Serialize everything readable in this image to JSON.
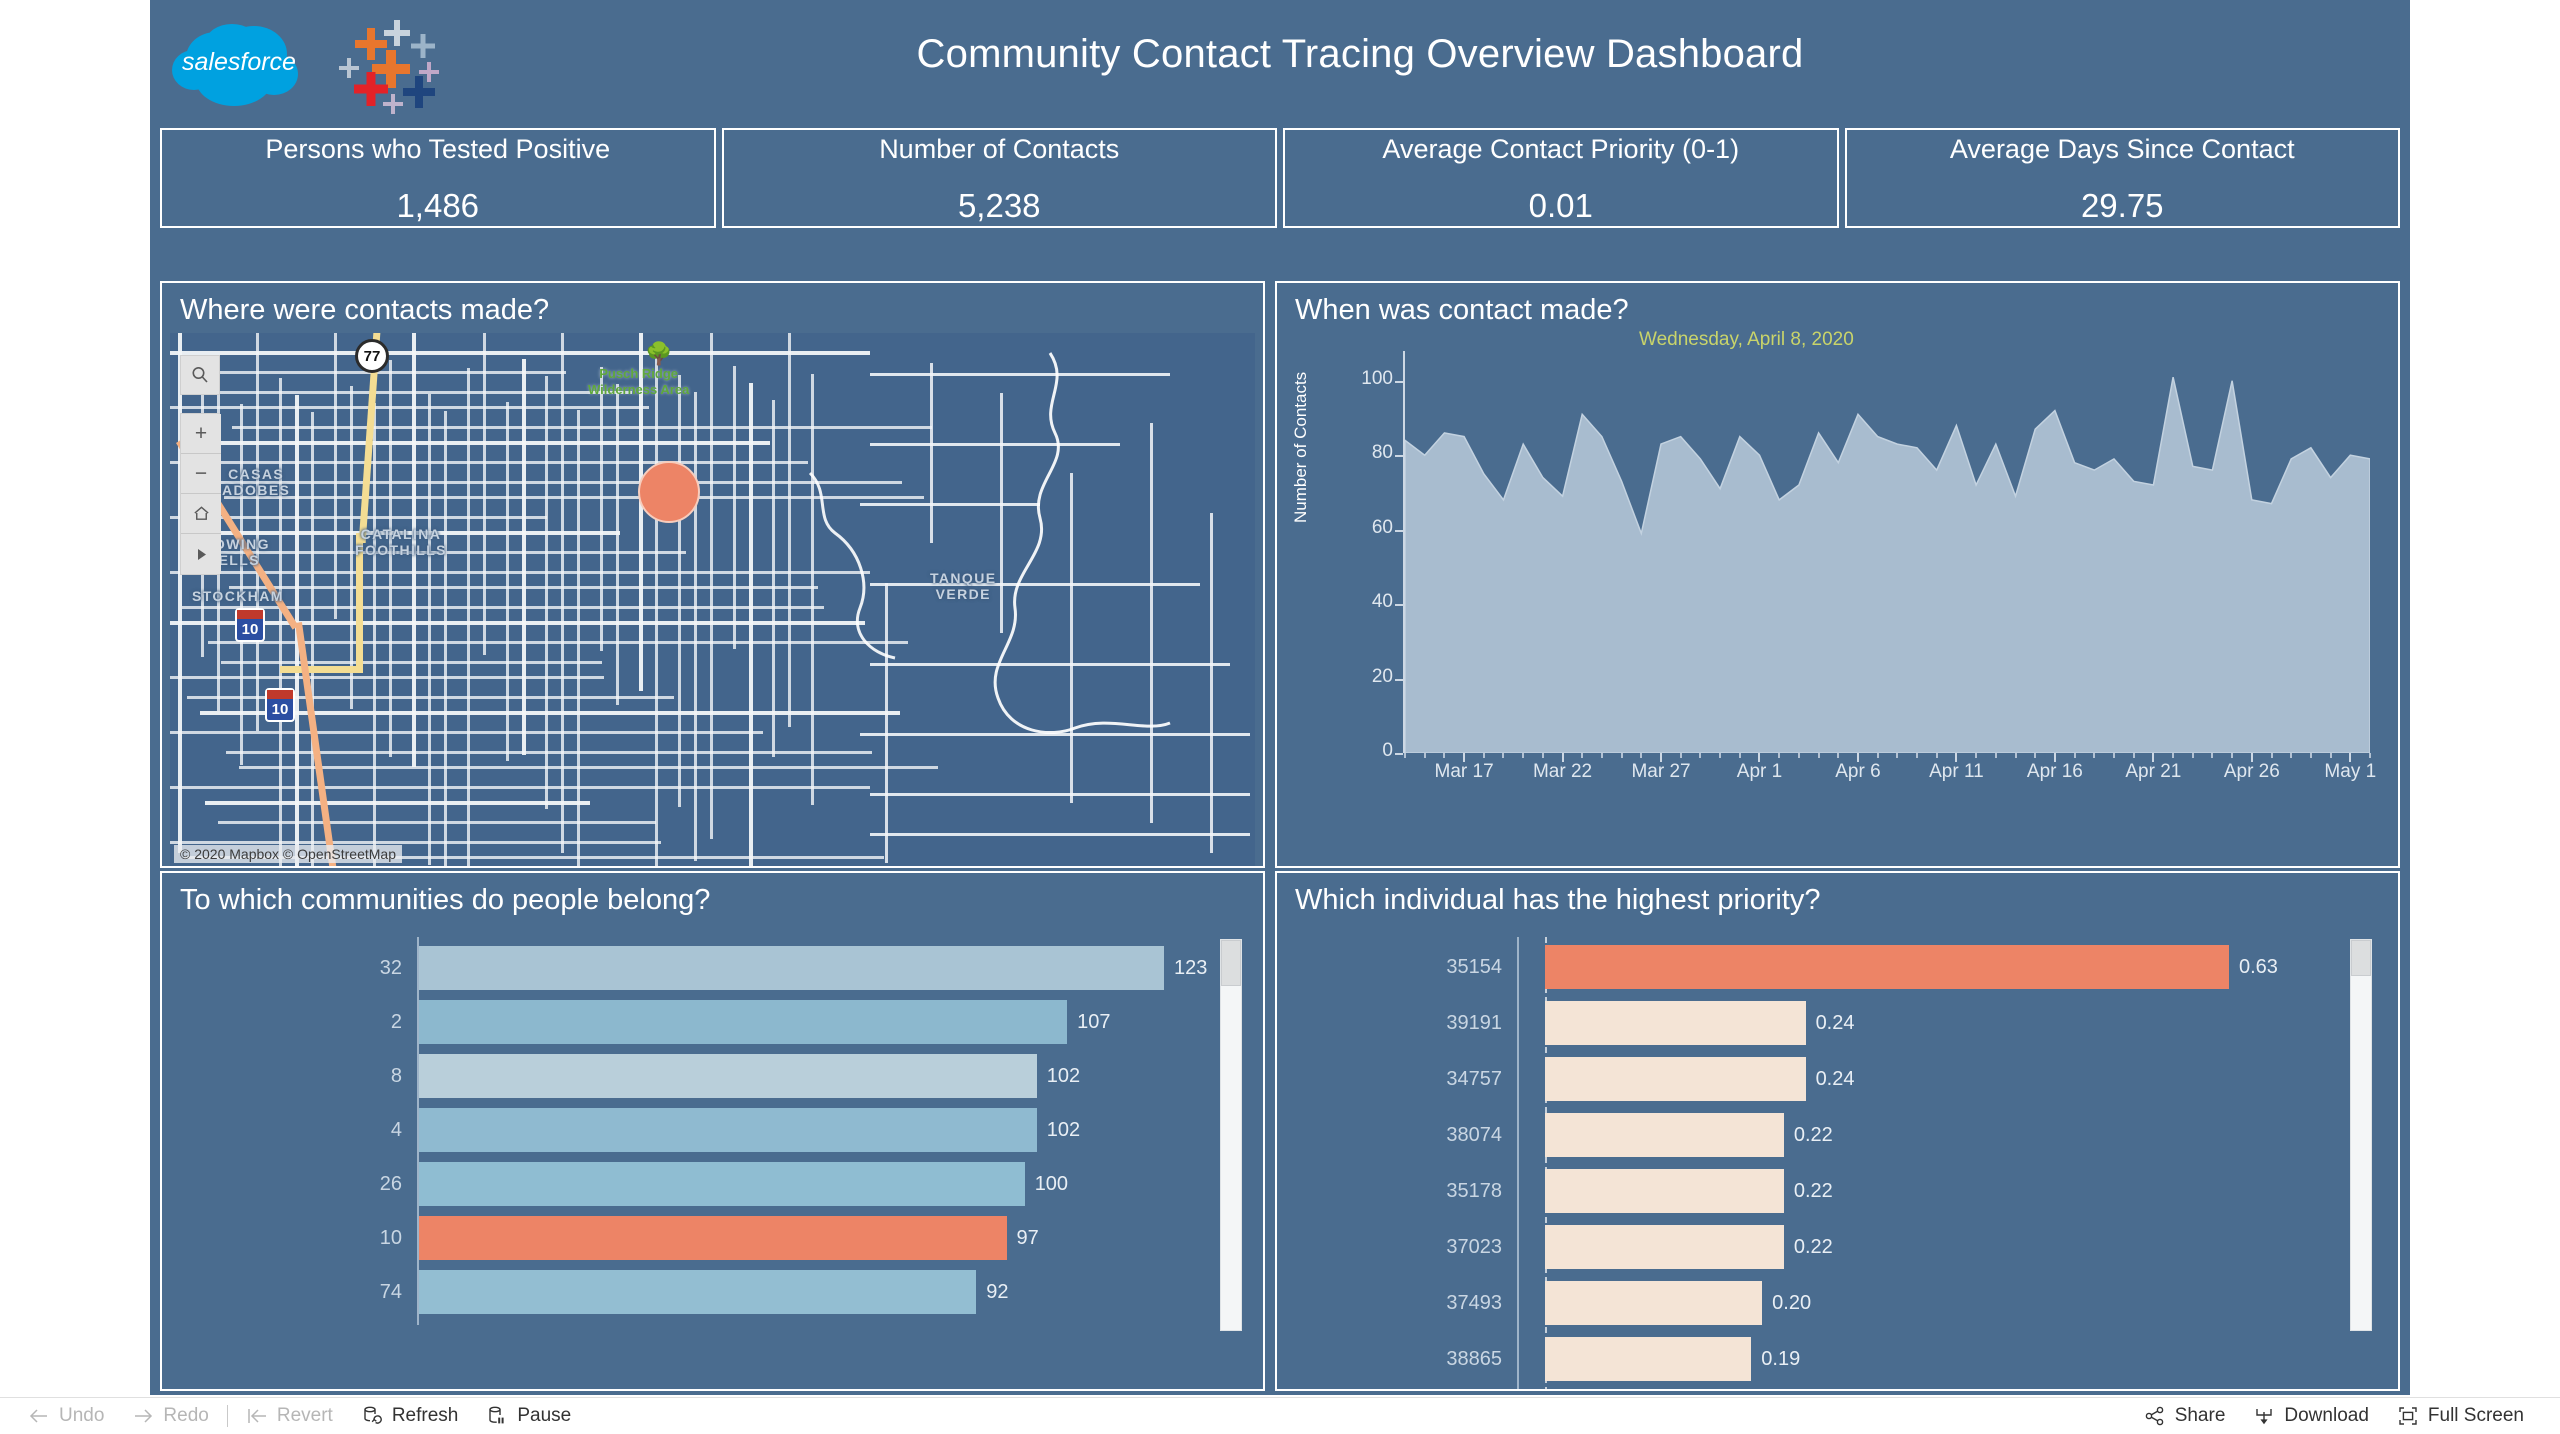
{
  "header": {
    "title": "Community Contact Tracing Overview Dashboard",
    "salesforce_logo_text": "salesforce",
    "tableau_logo_name": "tableau-logo"
  },
  "kpis": [
    {
      "label": "Persons who Tested Positive",
      "value": "1,486"
    },
    {
      "label": "Number of Contacts",
      "value": "5,238"
    },
    {
      "label": "Average Contact Priority (0-1)",
      "value": "0.01"
    },
    {
      "label": "Average Days Since Contact",
      "value": "29.75"
    }
  ],
  "panels": {
    "map": {
      "title": "Where were contacts made?",
      "attribution": "© 2020 Mapbox  © OpenStreetMap",
      "neighborhood_labels": [
        "CASAS\nADOBES",
        "CATALINA\nFOOTHILLS",
        "FLOWING\nWELLS",
        "STOCKHAM",
        "TANQUE\nVERDE"
      ],
      "park_label": "Pusch Ridge\nWilderness Area",
      "highway_labels": [
        "77",
        "10",
        "10"
      ],
      "controls": [
        "search-icon",
        "zoom-in-icon",
        "zoom-out-icon",
        "home-icon",
        "pan-icon"
      ]
    },
    "time": {
      "title": "When was contact made?"
    },
    "communities": {
      "title": "To which communities do people belong?"
    },
    "priority": {
      "title": "Which individual has the highest priority?"
    }
  },
  "chart_data": [
    {
      "id": "contacts-over-time",
      "type": "area",
      "title": "When was contact made?",
      "xlabel": "",
      "ylabel": "Number of Contacts",
      "ylim": [
        0,
        108
      ],
      "yticks": [
        0,
        20,
        40,
        60,
        80,
        100
      ],
      "xticks": [
        "Mar 17",
        "Mar 22",
        "Mar 27",
        "Apr 1",
        "Apr 6",
        "Apr 11",
        "Apr 16",
        "Apr 21",
        "Apr 26",
        "May 1"
      ],
      "annotation": "Wednesday, April 8, 2020",
      "grid": false,
      "legend": "none",
      "x": [
        "Mar 14",
        "Mar 15",
        "Mar 16",
        "Mar 17",
        "Mar 18",
        "Mar 19",
        "Mar 20",
        "Mar 21",
        "Mar 22",
        "Mar 23",
        "Mar 24",
        "Mar 25",
        "Mar 26",
        "Mar 27",
        "Mar 28",
        "Mar 29",
        "Mar 30",
        "Mar 31",
        "Apr 1",
        "Apr 2",
        "Apr 3",
        "Apr 4",
        "Apr 5",
        "Apr 6",
        "Apr 7",
        "Apr 8",
        "Apr 9",
        "Apr 10",
        "Apr 11",
        "Apr 12",
        "Apr 13",
        "Apr 14",
        "Apr 15",
        "Apr 16",
        "Apr 17",
        "Apr 18",
        "Apr 19",
        "Apr 20",
        "Apr 21",
        "Apr 22",
        "Apr 23",
        "Apr 24",
        "Apr 25",
        "Apr 26",
        "Apr 27",
        "Apr 28",
        "Apr 29",
        "Apr 30",
        "May 1",
        "May 2"
      ],
      "values": [
        84,
        80,
        86,
        85,
        75,
        68,
        83,
        74,
        69,
        91,
        85,
        73,
        59,
        83,
        85,
        79,
        71,
        85,
        80,
        68,
        72,
        86,
        78,
        91,
        85,
        83,
        82,
        76,
        88,
        72,
        83,
        69,
        87,
        92,
        78,
        76,
        79,
        73,
        72,
        101,
        77,
        76,
        100,
        68,
        67,
        79,
        82,
        74,
        80,
        79
      ]
    },
    {
      "id": "communities",
      "type": "bar",
      "orientation": "horizontal",
      "title": "To which communities do people belong?",
      "categories": [
        "32",
        "2",
        "8",
        "4",
        "26",
        "10",
        "74"
      ],
      "values": [
        123,
        107,
        102,
        102,
        100,
        97,
        92
      ],
      "value_labels": [
        "123",
        "107",
        "102",
        "102",
        "100",
        "97",
        "92"
      ],
      "xlim": [
        0,
        123
      ],
      "highlight_index": 5,
      "bar_colors": [
        "#a9c4d4",
        "#8cb8ce",
        "#b9cfda",
        "#8fbad0",
        "#8fbdd2",
        "#ed8466",
        "#93bed2"
      ],
      "highlight_color": "#ed8466"
    },
    {
      "id": "priority",
      "type": "bar",
      "orientation": "horizontal",
      "title": "Which individual has the highest priority?",
      "categories": [
        "35154",
        "39191",
        "34757",
        "38074",
        "35178",
        "37023",
        "37493",
        "38865"
      ],
      "values": [
        0.63,
        0.24,
        0.24,
        0.22,
        0.22,
        0.22,
        0.2,
        0.19
      ],
      "value_labels": [
        "0.63",
        "0.24",
        "0.24",
        "0.22",
        "0.22",
        "0.22",
        "0.20",
        "0.19"
      ],
      "xlim": [
        0,
        0.7
      ],
      "highlight_index": 0,
      "bar_color": "#f4e4d6",
      "highlight_color": "#ed8466"
    }
  ],
  "toolbar": {
    "left": [
      {
        "label": "Undo",
        "icon": "arrow-left-icon",
        "disabled": true
      },
      {
        "label": "Redo",
        "icon": "arrow-right-icon",
        "disabled": true
      },
      {
        "label": "Revert",
        "icon": "revert-icon",
        "disabled": true
      },
      {
        "label": "Refresh",
        "icon": "refresh-icon",
        "disabled": false
      },
      {
        "label": "Pause",
        "icon": "pause-icon",
        "disabled": false
      }
    ],
    "right": [
      {
        "label": "Share",
        "icon": "share-icon"
      },
      {
        "label": "Download",
        "icon": "download-icon"
      },
      {
        "label": "Full Screen",
        "icon": "fullscreen-icon"
      }
    ]
  },
  "colors": {
    "board_bg": "#4a6c8f",
    "map_bg": "#43658c",
    "accent_orange": "#ed8466",
    "area_fill": "#a8bccf",
    "text_light": "#ffffff",
    "annotation_green": "#c9d46a"
  }
}
